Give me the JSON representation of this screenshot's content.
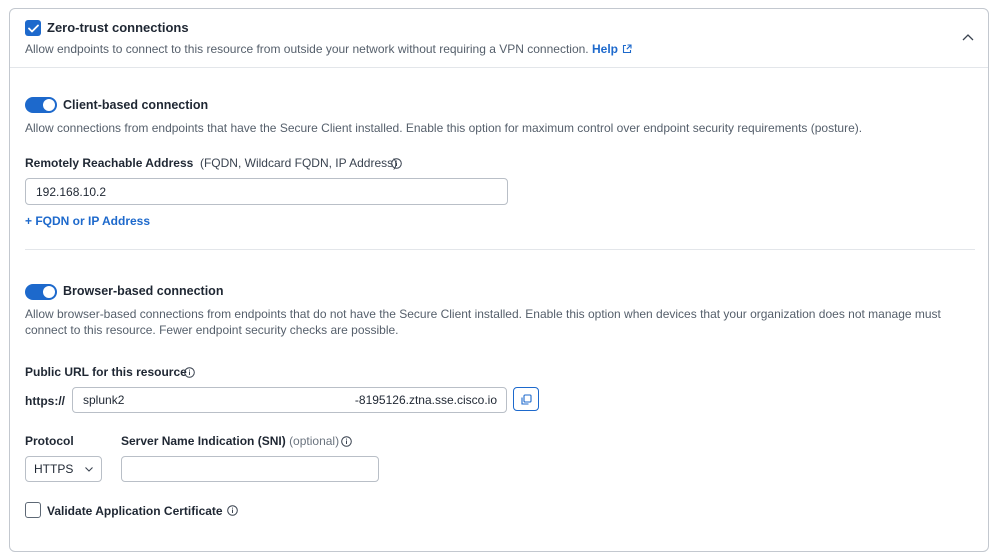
{
  "zero_trust": {
    "checked": true,
    "title": "Zero-trust connections",
    "description": "Allow endpoints to connect to this resource from outside your network without requiring a VPN connection.",
    "help_label": "Help"
  },
  "client_based": {
    "enabled": true,
    "title": "Client-based connection",
    "description": "Allow connections from endpoints that have the Secure Client installed. Enable this option for maximum control over endpoint security requirements (posture).",
    "address_label": "Remotely Reachable Address",
    "address_hint": "(FQDN, Wildcard FQDN, IP Address)",
    "address_value": "192.168.10.2",
    "add_address_label": "+ FQDN or IP Address"
  },
  "browser_based": {
    "enabled": true,
    "title": "Browser-based connection",
    "description_line1": "Allow browser-based connections from endpoints that do not have the Secure Client installed. Enable this option when devices that your organization does not manage must",
    "description_line2": "connect to this resource. Fewer endpoint security checks are possible.",
    "public_url_label": "Public URL for this resource",
    "url_prefix": "https://",
    "url_value": "splunk2",
    "url_suffix": "-8195126.ztna.sse.cisco.io",
    "protocol_label": "Protocol",
    "protocol_value": "HTTPS",
    "sni_label": "Server Name Indication (SNI)",
    "sni_optional": "(optional)",
    "sni_value": "",
    "validate_cert_label": "Validate Application Certificate",
    "validate_cert_checked": false
  },
  "colors": {
    "accent": "#1d69cc",
    "border": "#c3c8cf",
    "text": "#1f2733",
    "muted": "#555f6b"
  }
}
